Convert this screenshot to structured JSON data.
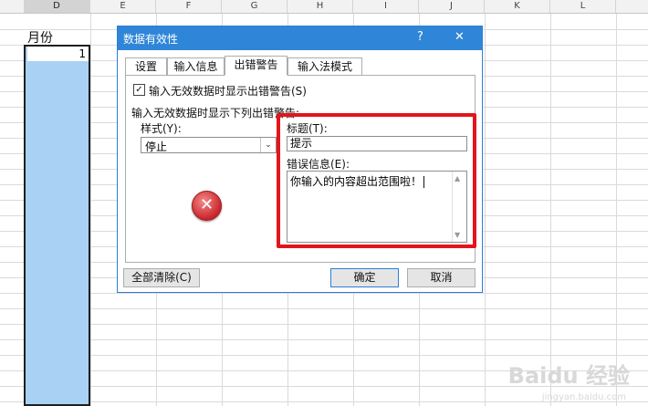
{
  "sheet": {
    "columns": [
      "D",
      "E",
      "F",
      "G",
      "H",
      "I",
      "J",
      "K",
      "L"
    ],
    "header_cell": "月份",
    "first_value": "1"
  },
  "dialog": {
    "title": "数据有效性",
    "help_label": "?",
    "close_label": "✕",
    "tabs": [
      "设置",
      "输入信息",
      "出错警告",
      "输入法模式"
    ],
    "active_tab": "出错警告",
    "show_alert_checkbox": {
      "label": "输入无效数据时显示出错警告(S)",
      "checked": true,
      "mark": "✓"
    },
    "section_label": "输入无效数据时显示下列出错警告:",
    "style_label": "样式(Y):",
    "style_value": "停止",
    "style_arrow": "⌄",
    "title_label": "标题(T):",
    "title_value": "提示",
    "message_label": "错误信息(E):",
    "message_value": "你输入的内容超出范围啦！",
    "scroll_up": "▲",
    "scroll_down": "▼",
    "error_icon_glyph": "✕",
    "clear_all_button": "全部清除(C)",
    "ok_button": "确定",
    "cancel_button": "取消"
  },
  "watermark": {
    "text": "Baidu 经验",
    "url": "jingyan.baidu.com"
  },
  "colors": {
    "titlebar": "#2f86d8",
    "selection": "#a9d1f3",
    "highlight_box": "#e4141c"
  }
}
